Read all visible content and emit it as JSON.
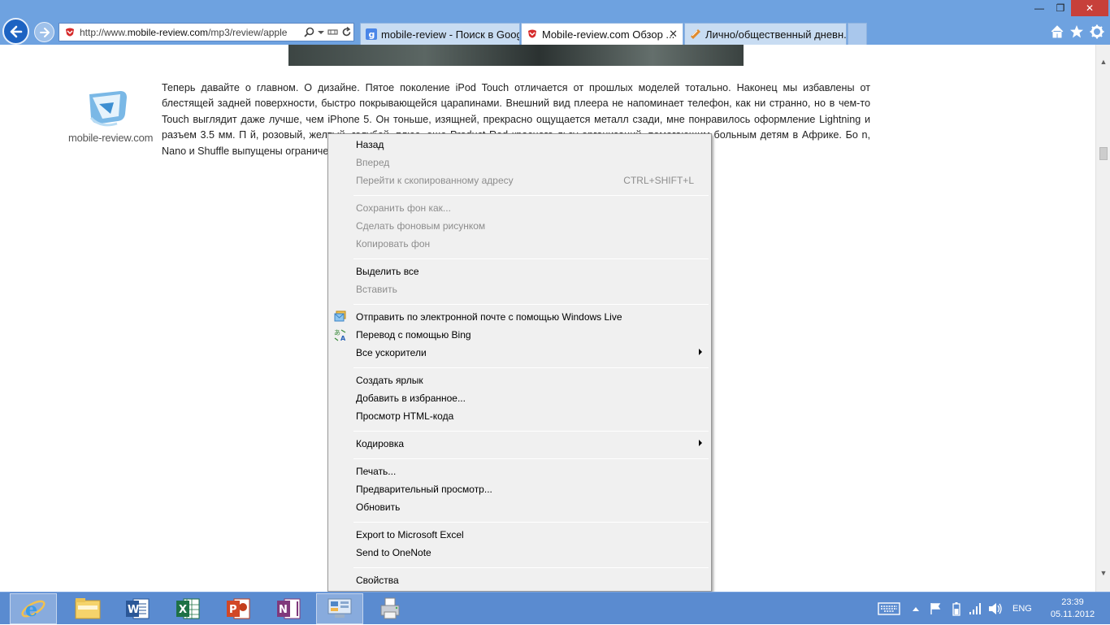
{
  "browser": {
    "address_bar": {
      "url_prefix": "http://www.",
      "url_domain": "mobile-review.com",
      "url_path": "/mp3/review/apple"
    },
    "tabs": [
      {
        "label": "mobile-review - Поиск в Google",
        "state": "inactive",
        "icon": "google-icon"
      },
      {
        "label": "Mobile-review.com Обзор ...",
        "state": "active",
        "icon": "site-favicon",
        "close": "✕"
      },
      {
        "label": "Лично/общественный дневн...",
        "state": "inactive",
        "icon": "site-favicon"
      }
    ],
    "window_buttons": {
      "minimize": "—",
      "restore": "❐",
      "close": "✕"
    }
  },
  "page": {
    "logo_text": "mobile-review.com",
    "paragraph": "Теперь давайте о главном. О дизайне. Пятое поколение iPod Touch отличается от прошлых моделей тотально. Наконец мы избавлены от блестящей задней поверхности, быстро покрывающейся царапинами. Внешний вид плеера не напоминает телефон, как ни странно, но в чем-то Touch выглядит даже лучше, чем iPhone 5. Он тоньше, изящней, прекрасно ощущается металл сзади, мне понравилось оформление Lightning и разъем 3.5 мм. П                                                                   й, розовый, желтый, голубой, плюс, еще Product Red красного                                                                  льзу организаций, помогающим больным детям в Африке. Бо                                                                  n, Nano и Shuffle выпущены ограниченным тиражом, со врем                                                                  pple. Так что, торопитесь."
  },
  "context_menu": {
    "items": [
      {
        "label": "Назад",
        "disabled": false
      },
      {
        "label": "Вперед",
        "disabled": true
      },
      {
        "label": "Перейти к скопированному адресу",
        "disabled": true,
        "shortcut": "CTRL+SHIFT+L"
      },
      {
        "label": "Сохранить фон как...",
        "disabled": true
      },
      {
        "label": "Сделать фоновым рисунком",
        "disabled": true
      },
      {
        "label": "Копировать фон",
        "disabled": true
      },
      {
        "label": "Выделить все",
        "disabled": false
      },
      {
        "label": "Вставить",
        "disabled": true
      },
      {
        "label": "Отправить по электронной почте с помощью Windows Live",
        "disabled": false,
        "icon": "windows-live-mail-icon"
      },
      {
        "label": "Перевод с помощью Bing",
        "disabled": false,
        "icon": "bing-translate-icon"
      },
      {
        "label": "Все ускорители",
        "disabled": false,
        "submenu": true
      },
      {
        "label": "Создать ярлык",
        "disabled": false
      },
      {
        "label": "Добавить в избранное...",
        "disabled": false
      },
      {
        "label": "Просмотр HTML-кода",
        "disabled": false
      },
      {
        "label": "Кодировка",
        "disabled": false,
        "submenu": true
      },
      {
        "label": "Печать...",
        "disabled": false
      },
      {
        "label": "Предварительный просмотр...",
        "disabled": false
      },
      {
        "label": "Обновить",
        "disabled": false
      },
      {
        "label": "Export to Microsoft Excel",
        "disabled": false
      },
      {
        "label": "Send to OneNote",
        "disabled": false
      },
      {
        "label": "Свойства",
        "disabled": false
      }
    ]
  },
  "taskbar": {
    "apps": [
      {
        "name": "Internet Explorer",
        "icon": "internet-explorer-icon",
        "active": true
      },
      {
        "name": "File Explorer",
        "icon": "file-explorer-icon",
        "active": false
      },
      {
        "name": "Microsoft Word",
        "icon": "word-icon",
        "active": false
      },
      {
        "name": "Microsoft Excel",
        "icon": "excel-icon",
        "active": false
      },
      {
        "name": "Microsoft PowerPoint",
        "icon": "powerpoint-icon",
        "active": false
      },
      {
        "name": "Microsoft OneNote",
        "icon": "onenote-icon",
        "active": false
      },
      {
        "name": "Remote Desktop",
        "icon": "remote-desktop-icon",
        "active": true
      },
      {
        "name": "Printer",
        "icon": "printer-icon",
        "active": false
      }
    ],
    "language": "ENG",
    "time": "23:39",
    "date": "05.11.2012"
  },
  "colors": {
    "chrome_blue": "#6ea2e0",
    "taskbar_blue": "#5a8bd0",
    "menu_bg": "#f0f0f0",
    "disabled_text": "#8d8d8d"
  }
}
